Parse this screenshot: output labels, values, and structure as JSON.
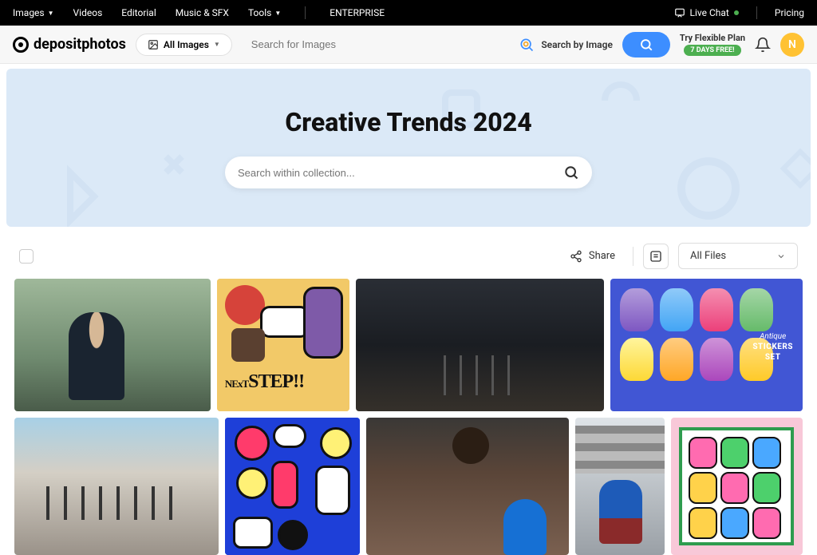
{
  "topnav": {
    "images": "Images",
    "videos": "Videos",
    "editorial": "Editorial",
    "music": "Music & SFX",
    "tools": "Tools",
    "enterprise": "ENTERPRISE",
    "livechat": "Live Chat",
    "pricing": "Pricing"
  },
  "header": {
    "logo": "depositphotos",
    "all_images": "All Images",
    "search_placeholder": "Search for Images",
    "search_by_image": "Search by Image",
    "flex_plan": "Try Flexible Plan",
    "flex_badge": "7 DAYS FREE!",
    "avatar_letter": "N"
  },
  "hero": {
    "title": "Creative Trends 2024",
    "search_placeholder": "Search within collection..."
  },
  "toolbar": {
    "share": "Share",
    "filter": "All Files"
  },
  "doodle_a_text": "STEP!!",
  "doodle_a_prefix": "NExT",
  "stickers": {
    "line1": "Antique",
    "line2": "STICKERS",
    "line3": "SET"
  }
}
